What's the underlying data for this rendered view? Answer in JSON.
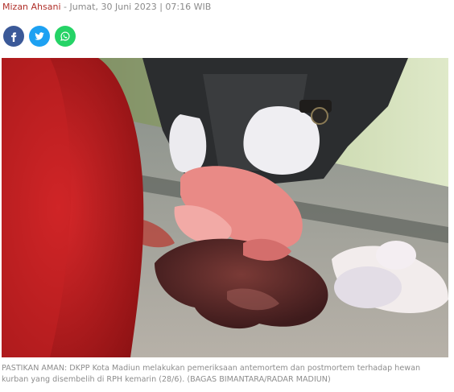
{
  "article": {
    "author": "Mizan Ahsani",
    "separator": " - ",
    "date": "Jumat, 30 Juni 2023 | 07:16 WIB"
  },
  "share": {
    "buttons": [
      {
        "icon": "facebook-icon",
        "color": "#3b5998"
      },
      {
        "icon": "twitter-icon",
        "color": "#1da1f2"
      },
      {
        "icon": "whatsapp-icon",
        "color": "#25d366"
      }
    ]
  },
  "caption": "PASTIKAN AMAN: DKPP Kota Madiun melakukan pemeriksaan antemortem dan postmortem terhadap hewan kurban yang disembelih di RPH kemarin (28/6). (BAGAS BIMANTARA/RADAR MADIUN)"
}
